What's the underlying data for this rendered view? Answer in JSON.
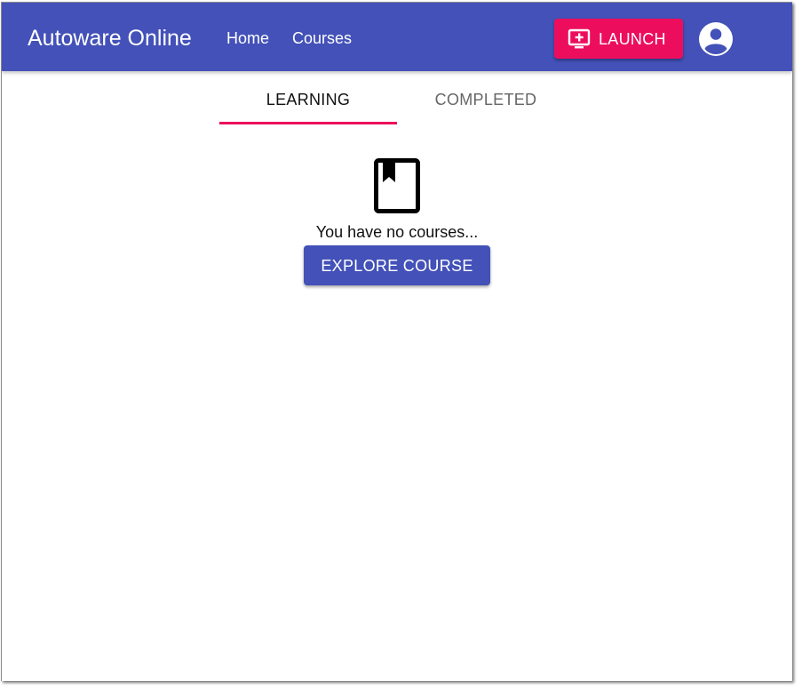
{
  "app": {
    "title": "Autoware Online"
  },
  "nav": {
    "items": [
      {
        "label": "Home"
      },
      {
        "label": "Courses"
      }
    ]
  },
  "toolbar": {
    "launch_label": "LAUNCH",
    "launch_icon": "add-to-queue-icon",
    "account_icon": "account-circle-icon"
  },
  "tabs": [
    {
      "label": "LEARNING",
      "selected": true
    },
    {
      "label": "COMPLETED",
      "selected": false
    }
  ],
  "empty_state": {
    "icon": "book-icon",
    "message": "You have no courses...",
    "button_label": "EXPLORE COURSE"
  },
  "colors": {
    "primary": "#4351b8",
    "accent": "#ec0e5c",
    "background": "#ffffff"
  }
}
